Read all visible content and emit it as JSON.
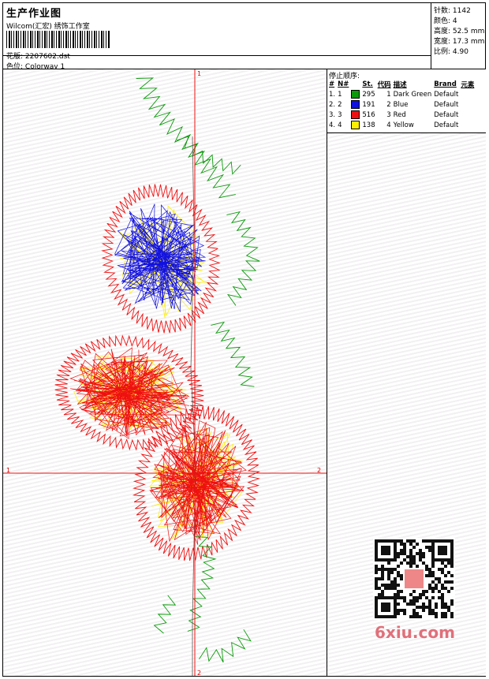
{
  "header": {
    "title": "生产作业图",
    "subtitle": "Wilcom(汇宏) 绣饰工作室",
    "design_label": "花版:",
    "design_value": "2207602.dst",
    "colorway_label": "色位:",
    "colorway_value": "Colorway 1"
  },
  "stats": {
    "stitches_label": "针数:",
    "stitches_value": "1142",
    "colors_label": "颜色:",
    "colors_value": "4",
    "height_label": "高度:",
    "height_value": "52.5 mm",
    "width_label": "宽度:",
    "width_value": "17.3 mm",
    "scale_label": "比例:",
    "scale_value": "4.90"
  },
  "stop_sequence": {
    "title": "停止顺序:",
    "columns": [
      "#",
      "N#",
      "St.",
      "代码",
      "描述",
      "Brand",
      "元素"
    ],
    "rows": [
      {
        "num": "1.",
        "n": "1",
        "color": "#0a9a0a",
        "st": "295",
        "code": "1",
        "desc": "Dark Green",
        "brand": "Default"
      },
      {
        "num": "2.",
        "n": "2",
        "color": "#1010e0",
        "st": "191",
        "code": "2",
        "desc": "Blue",
        "brand": "Default"
      },
      {
        "num": "3.",
        "n": "3",
        "color": "#ee1010",
        "st": "516",
        "code": "3",
        "desc": "Red",
        "brand": "Default"
      },
      {
        "num": "4.",
        "n": "4",
        "color": "#ffee00",
        "st": "138",
        "code": "4",
        "desc": "Yellow",
        "brand": "Default"
      }
    ]
  },
  "axes": {
    "top": "1",
    "bottom": "2",
    "left": "1",
    "right": "2"
  },
  "watermark": "6xiu.com",
  "colors": {
    "axis": "#ee1010",
    "green": "#0a9a0a",
    "blue": "#1010e0",
    "red": "#ee1010",
    "yellow": "#ffee00"
  }
}
